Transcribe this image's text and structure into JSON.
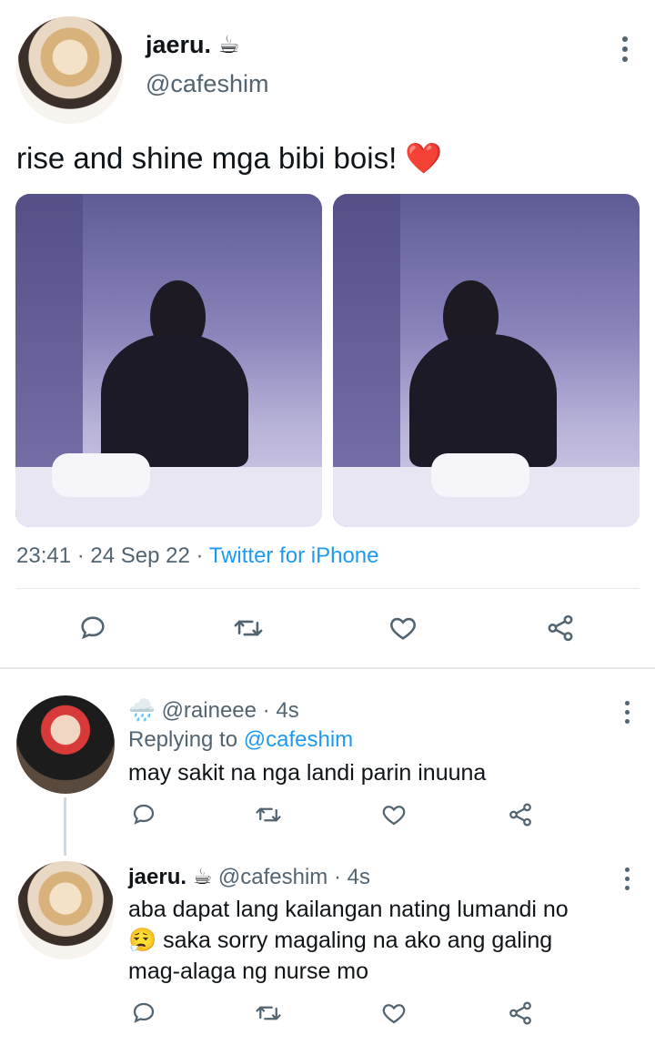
{
  "tweet": {
    "author_name": "jaeru.",
    "author_emoji": "☕",
    "author_handle": "@cafeshim",
    "text": "rise and shine mga bibi bois!",
    "text_emoji": "❤️",
    "time": "23:41",
    "date": "24 Sep 22",
    "sep": "·",
    "source": "Twitter for iPhone"
  },
  "replies": [
    {
      "emoji": "🌧️",
      "handle": "@raineee",
      "time": "4s",
      "replying_label": "Replying to",
      "replying_to": "@cafeshim",
      "text": "may sakit na nga landi parin inuuna"
    },
    {
      "name": "jaeru.",
      "emoji": "☕",
      "handle": "@cafeshim",
      "time": "4s",
      "text_line1": "aba dapat lang kailangan nating lumandi no",
      "text_line2_emoji": "😮‍💨",
      "text_line2": "saka sorry magaling na ako ang galing",
      "text_line3": "mag-alaga ng nurse mo"
    }
  ],
  "icons": [
    "more-vertical-icon",
    "reply-icon",
    "retweet-icon",
    "like-icon",
    "share-icon"
  ],
  "colors": {
    "link": "#1d9bf0",
    "muted": "#536471",
    "text": "#0f1419"
  }
}
